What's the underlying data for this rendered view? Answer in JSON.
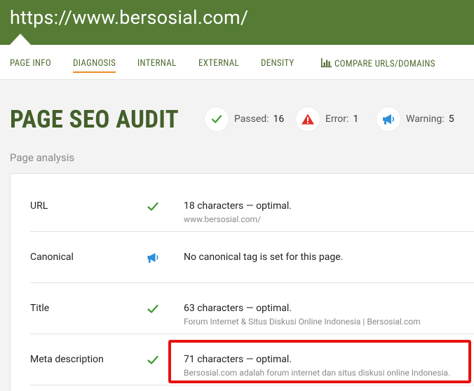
{
  "header": {
    "url": "https://www.bersosial.com/"
  },
  "nav": {
    "tabs": [
      {
        "label": "PAGE INFO",
        "active": false
      },
      {
        "label": "DIAGNOSIS",
        "active": true
      },
      {
        "label": "INTERNAL",
        "active": false
      },
      {
        "label": "EXTERNAL",
        "active": false
      },
      {
        "label": "DENSITY",
        "active": false
      },
      {
        "label": "COMPARE URLS/DOMAINS",
        "active": false,
        "icon": "bar-chart-icon"
      }
    ]
  },
  "audit": {
    "title": "PAGE SEO AUDIT",
    "stats": {
      "passed": {
        "label": "Passed:",
        "value": "16",
        "icon": "check-icon",
        "color": "#3c9b2d"
      },
      "error": {
        "label": "Error:",
        "value": "1",
        "icon": "warning-triangle-icon",
        "color": "#e2302a"
      },
      "warning": {
        "label": "Warning:",
        "value": "5",
        "icon": "megaphone-icon",
        "color": "#2f8fd8"
      }
    }
  },
  "analysis": {
    "label": "Page analysis",
    "rows": [
      {
        "name": "URL",
        "status": "check-icon",
        "main": "18 characters — optimal.",
        "sub": "www.bersosial.com/"
      },
      {
        "name": "Canonical",
        "status": "megaphone-icon",
        "main": "No canonical tag is set for this page.",
        "sub": ""
      },
      {
        "name": "Title",
        "status": "check-icon",
        "main": "63 characters — optimal.",
        "sub": "Forum Internet & Situs Diskusi Online Indonesia | Bersosial.com"
      },
      {
        "name": "Meta description",
        "status": "check-icon",
        "main": "71 characters — optimal.",
        "sub": "Bersosial.com adalah forum internet dan situs diskusi online Indonesia."
      }
    ]
  },
  "colors": {
    "header": "#557b35",
    "accent": "#f08a24",
    "highlight": "#e8100e"
  }
}
